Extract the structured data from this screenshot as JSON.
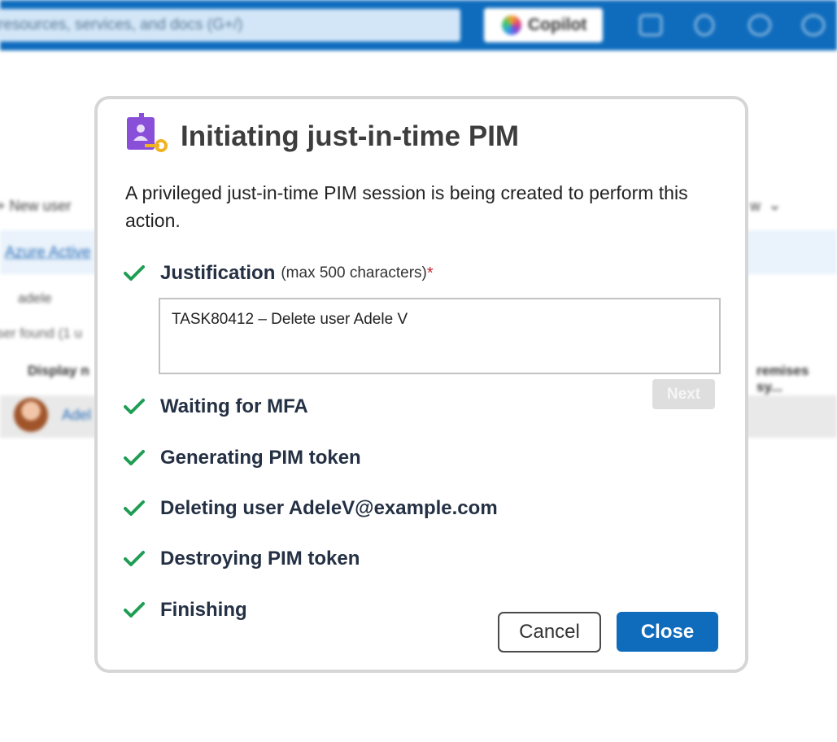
{
  "background": {
    "search_placeholder": "resources, services, and docs (G+/)",
    "copilot_label": "Copilot",
    "toolbar_new_user": "+ New user",
    "toolbar_right": "w",
    "directory_link": "Azure Active",
    "filter_value": "adele",
    "found_text": "ser found (1 u",
    "column_display": "Display n",
    "column_premises": "remises sy...",
    "user_name": "Adel"
  },
  "dialog": {
    "title": "Initiating just-in-time PIM",
    "description": "A privileged just-in-time PIM session is being created to perform this action.",
    "justification": {
      "label": "Justification",
      "hint": "(max 500 characters)",
      "required_mark": "*",
      "value": "TASK80412 – Delete user Adele V"
    },
    "next_label": "Next",
    "steps": [
      {
        "label": "Waiting for MFA",
        "status": "done"
      },
      {
        "label": "Generating PIM token",
        "status": "done"
      },
      {
        "label": "Deleting user AdeleV@example.com",
        "status": "done"
      },
      {
        "label": "Destroying PIM token",
        "status": "done"
      },
      {
        "label": "Finishing",
        "status": "done"
      }
    ],
    "cancel_label": "Cancel",
    "close_label": "Close"
  },
  "colors": {
    "brand": "#0f6cbd",
    "check": "#1f9d55",
    "required": "#c4262e",
    "icon_purple": "#8a4fd8",
    "icon_key": "#f0b323"
  }
}
